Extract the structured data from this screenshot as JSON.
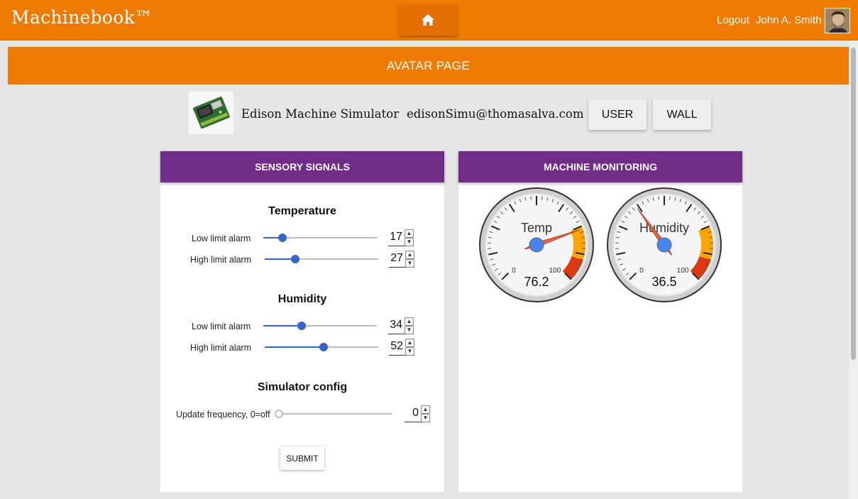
{
  "topbar": {
    "brand": "Machinebook™",
    "logout": "Logout",
    "username": "John A. Smith",
    "home_icon": "home-icon"
  },
  "page_header": "AVATAR PAGE",
  "device": {
    "name": "Edison Machine Simulator",
    "email": "edisonSimu@thomasalva.com",
    "user_button": "USER",
    "wall_button": "WALL"
  },
  "sensory": {
    "title": "SENSORY SIGNALS",
    "temperature": {
      "title": "Temperature",
      "low_label": "Low limit alarm",
      "low_value": "17",
      "high_label": "High limit alarm",
      "high_value": "27"
    },
    "humidity": {
      "title": "Humidity",
      "low_label": "Low limit alarm",
      "low_value": "34",
      "high_label": "High limit alarm",
      "high_value": "52"
    },
    "config": {
      "title": "Simulator config",
      "freq_label": "Update frequency, 0=off",
      "freq_value": "0"
    },
    "submit": "SUBMIT"
  },
  "monitoring": {
    "title": "MACHINE MONITORING",
    "gauges": [
      {
        "label": "Temp",
        "value": "76.2",
        "min": "0",
        "max": "100",
        "needle": 76.2
      },
      {
        "label": "Humidity",
        "value": "36.5",
        "min": "0",
        "max": "100",
        "needle": 36.5
      }
    ]
  },
  "colors": {
    "accent": "#ee7b00",
    "panel_header": "#712c87",
    "slider": "#3a63c8",
    "gauge_yellow": "#ffa500",
    "gauge_red": "#dc3912"
  },
  "sliders": {
    "temp_low": 17,
    "temp_high": 27,
    "hum_low": 34,
    "hum_high": 52,
    "freq": 0,
    "max": 100
  }
}
